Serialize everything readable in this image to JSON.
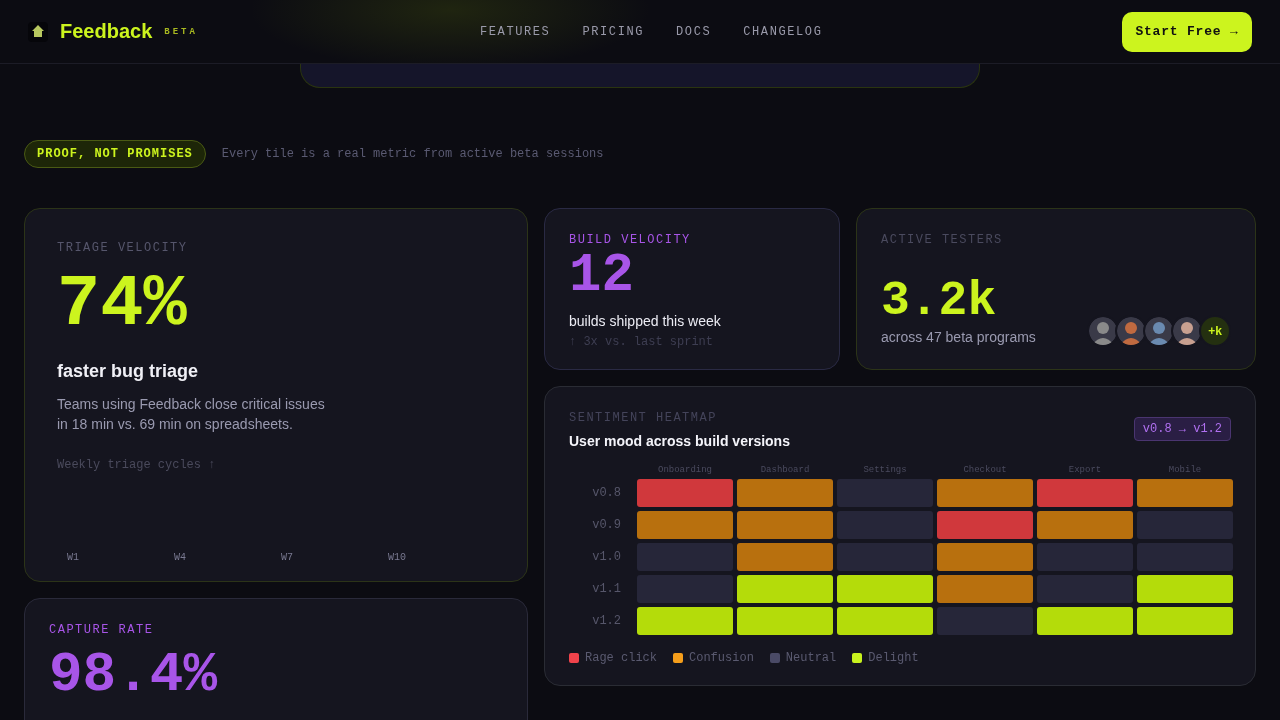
{
  "header": {
    "brand": "Feedback",
    "badge": "BETA",
    "nav": [
      {
        "label": "FEATURES"
      },
      {
        "label": "PRICING"
      },
      {
        "label": "DOCS"
      },
      {
        "label": "CHANGELOG"
      }
    ],
    "cta": "Start Free →"
  },
  "intro": {
    "tag": "PROOF, NOT PROMISES",
    "text": "Every tile is a real metric from active beta sessions"
  },
  "triage": {
    "label": "TRIAGE VELOCITY",
    "value": "74%",
    "subtitle": "faster bug triage",
    "description": "Teams using Feedback close critical issues in 18 min vs. 69 min on spreadsheets.",
    "chart_label": "Weekly triage cycles ↑",
    "weeks": [
      "W1",
      "W4",
      "W7",
      "W10"
    ]
  },
  "build": {
    "label": "BUILD VELOCITY",
    "value": "12",
    "caption": "builds shipped this week",
    "delta": "↑ 3x vs. last sprint"
  },
  "testers": {
    "label": "ACTIVE TESTERS",
    "value": "3.2k",
    "caption": "across 47 beta programs",
    "more": "+k"
  },
  "heatmap": {
    "label": "SENTIMENT HEATMAP",
    "title": "User mood across build versions",
    "range": "v0.8 → v1.2",
    "columns": [
      "Onboarding",
      "Dashboard",
      "Settings",
      "Checkout",
      "Export",
      "Mobile"
    ],
    "rows": [
      {
        "version": "v0.8",
        "cells": [
          {
            "color": "#d0383c"
          },
          {
            "color": "#b8700e"
          },
          {
            "color": "#262639"
          },
          {
            "color": "#b8700e"
          },
          {
            "color": "#d0383c"
          },
          {
            "color": "#b8700e"
          }
        ]
      },
      {
        "version": "v0.9",
        "cells": [
          {
            "color": "#b8700e"
          },
          {
            "color": "#b8700e"
          },
          {
            "color": "#262639"
          },
          {
            "color": "#d0383c"
          },
          {
            "color": "#b8700e"
          },
          {
            "color": "#262639"
          }
        ]
      },
      {
        "version": "v1.0",
        "cells": [
          {
            "color": "#262639"
          },
          {
            "color": "#b8700e"
          },
          {
            "color": "#262639"
          },
          {
            "color": "#b8700e"
          },
          {
            "color": "#262639"
          },
          {
            "color": "#262639"
          }
        ]
      },
      {
        "version": "v1.1",
        "cells": [
          {
            "color": "#262639"
          },
          {
            "color": "#b4dc0a"
          },
          {
            "color": "#b4dc0a"
          },
          {
            "color": "#b8700e"
          },
          {
            "color": "#262639"
          },
          {
            "color": "#b4dc0a"
          }
        ]
      },
      {
        "version": "v1.2",
        "cells": [
          {
            "color": "#b4dc0a"
          },
          {
            "color": "#b4dc0a"
          },
          {
            "color": "#b4dc0a"
          },
          {
            "color": "#262639"
          },
          {
            "color": "#b4dc0a"
          },
          {
            "color": "#b4dc0a"
          }
        ]
      }
    ],
    "legend": [
      {
        "label": "Rage click",
        "color": "#f0434b"
      },
      {
        "label": "Confusion",
        "color": "#f59e1b"
      },
      {
        "label": "Neutral",
        "color": "#4a4a66"
      },
      {
        "label": "Delight",
        "color": "#c8f21e"
      }
    ]
  },
  "capture": {
    "label": "CAPTURE RATE",
    "value": "98.4%"
  }
}
